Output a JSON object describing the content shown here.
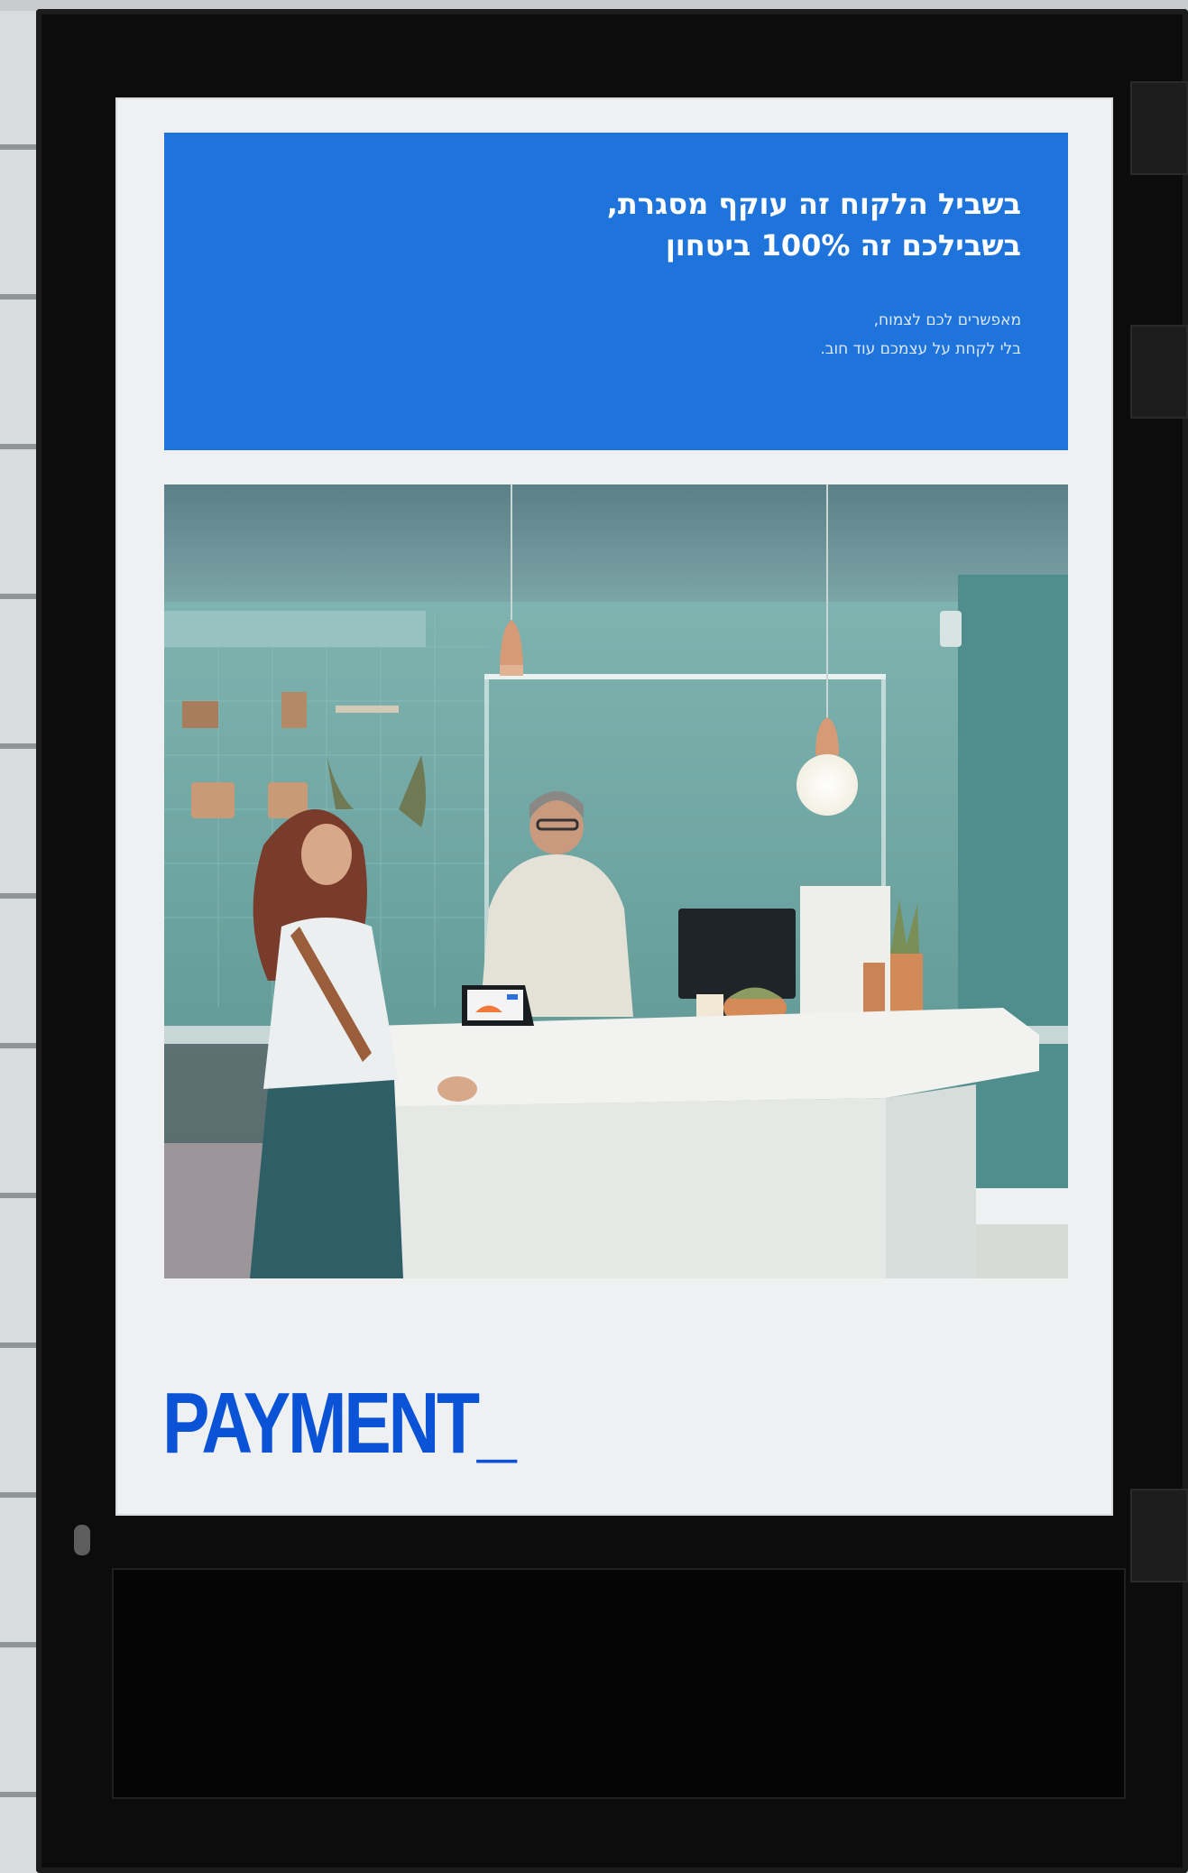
{
  "poster": {
    "headline_line1": "בשביל הלקוח זה עוקף מסגרת,",
    "headline_line2": "בשבילכם זה 100% ביטחון",
    "subline_line1": "מאפשרים לכם לצמוח,",
    "subline_line2": "בלי לקחת על עצמכם עוד חוב.",
    "logo": "PAYMENT_"
  },
  "colors": {
    "banner": "#1f74dc",
    "logo": "#0b53d6",
    "poster_bg": "#eef0f1",
    "frame": "#0c0c0c"
  }
}
